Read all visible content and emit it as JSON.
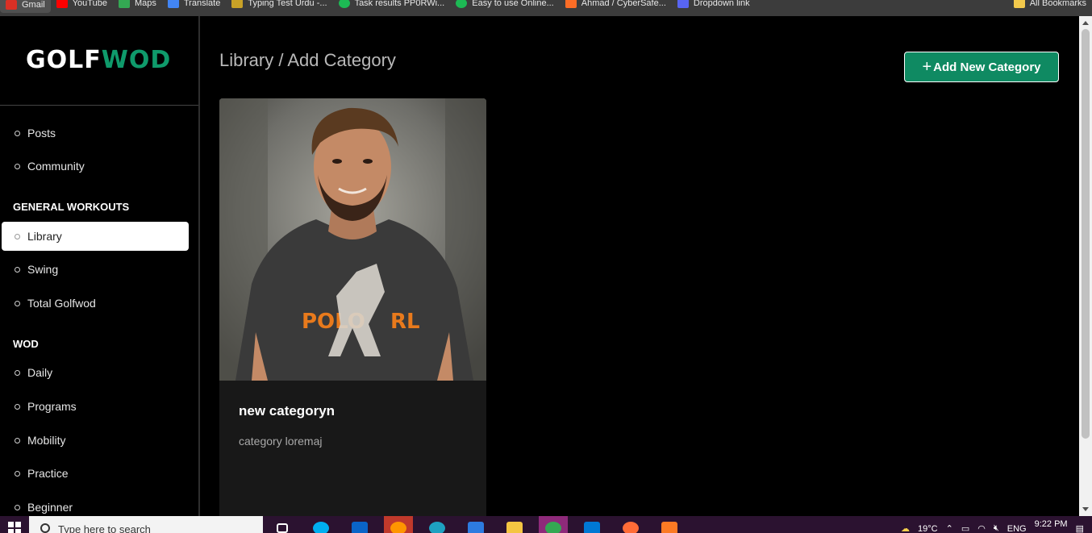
{
  "bookmarks": [
    {
      "label": "Gmail",
      "color": "#d93025"
    },
    {
      "label": "YouTube",
      "color": "#ff0000"
    },
    {
      "label": "Maps",
      "color": "#34a853"
    },
    {
      "label": "Translate",
      "color": "#4285f4"
    },
    {
      "label": "Typing Test Urdu -...",
      "color": "#c9a227"
    },
    {
      "label": "Task results PP0RWi...",
      "color": "#1db954"
    },
    {
      "label": "Easy to use Online...",
      "color": "#1db954"
    },
    {
      "label": "Ahmad / CyberSafe...",
      "color": "#fc6d26"
    },
    {
      "label": "Dropdown link",
      "color": "#5865f2"
    }
  ],
  "bookmarks_right": "All Bookmarks",
  "logo": {
    "part1": "GOLF",
    "part2": "WOD"
  },
  "sidebar": {
    "items_top": [
      {
        "label": "Posts"
      },
      {
        "label": "Community"
      }
    ],
    "section_general": "GENERAL WORKOUTS",
    "items_general": [
      {
        "label": "Library",
        "active": true
      },
      {
        "label": "Swing"
      },
      {
        "label": "Total Golfwod"
      }
    ],
    "section_wod": "WOD",
    "items_wod": [
      {
        "label": "Daily"
      },
      {
        "label": "Programs"
      },
      {
        "label": "Mobility"
      },
      {
        "label": "Practice"
      },
      {
        "label": "Beginner"
      }
    ]
  },
  "main": {
    "title": "Library / Add Category",
    "add_button": {
      "icon": "+",
      "label": "Add New Category"
    },
    "cards": [
      {
        "title": "new categoryn",
        "description": "category loremaj",
        "image": "person-photo"
      }
    ]
  },
  "taskbar": {
    "search_placeholder": "Type here to search",
    "weather": "19°C",
    "language": "ENG",
    "time": "9:22 PM"
  },
  "colors": {
    "accent": "#0f8a62",
    "logo_green": "#0f9a6b",
    "background": "#000000",
    "card_bg": "#181818"
  }
}
